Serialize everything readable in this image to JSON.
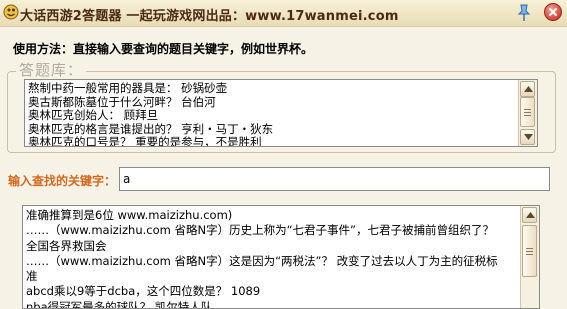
{
  "window": {
    "title": "大话西游2答题器  一起玩游戏网出品：www.17wanmei.com"
  },
  "usage": {
    "text": "使用方法：直接输入要查询的题目关键字，例如世界杯。"
  },
  "answer_box": {
    "legend": "答题库：",
    "lines": [
      "熬制中药一般常用的器具是： 砂锅砂壶",
      "奥古斯都陈墓位于什么河畔？ 台伯河",
      "奥林匹克创始人：   顾拜旦",
      "奥林匹克的格言是谁提出的？ 亨利・马丁・狄东",
      "奥林匹克的口号是？  重要的是参与，不是胜利"
    ]
  },
  "search": {
    "label": "输入查找的关键字：",
    "value": "a"
  },
  "results": {
    "lines": [
      "准确推算到是6位 www.maizizhu.com)",
      "……（www.maizizhu.com 省略N字）历史上称为“七君子事件”，七君子被捕前曾组织了？",
      "全国各界救国会",
      "……（www.maizizhu.com 省略N字）这是因为“两税法”？  改变了过去以人丁为主的征税标",
      "准",
      "abcd乘以9等于dcba，这个四位数是？    1089",
      "nba得冠军最多的球队？    凯尔特人队"
    ]
  },
  "colors": {
    "search_label": "#d2691e",
    "legend": "#b1aba0",
    "title": "#4a2a14"
  }
}
